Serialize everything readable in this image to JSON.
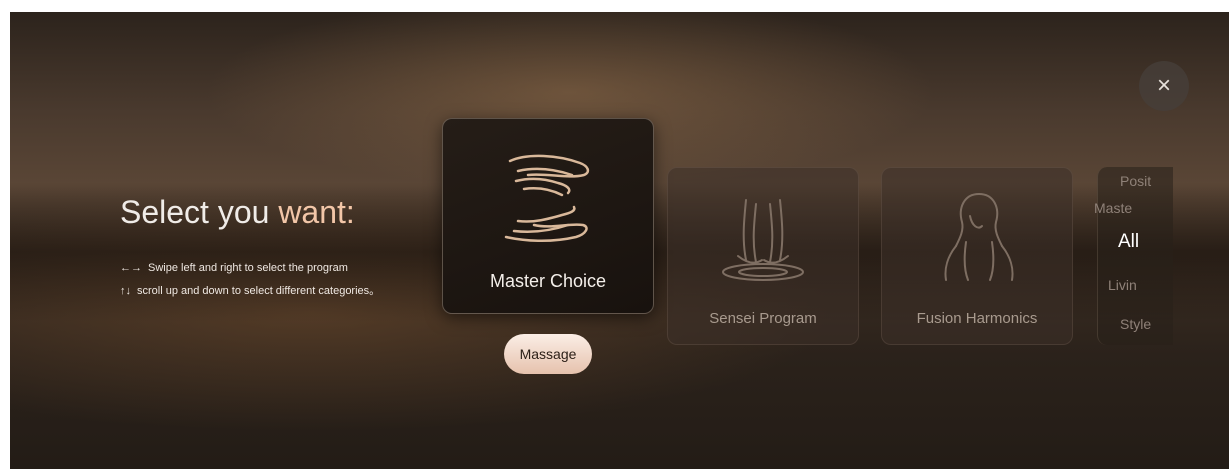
{
  "close": {
    "label": "×"
  },
  "intro": {
    "title_main": "Select you ",
    "title_accent": "want",
    "title_colon": ":",
    "hints": [
      {
        "arrows": "←→",
        "text": "Swipe left and right to select the program"
      },
      {
        "arrows": "↑↓",
        "text": "scroll up and down to select different categories。"
      }
    ]
  },
  "cards": [
    {
      "label": "Master Choice",
      "icon": "hands-icon",
      "selected": true
    },
    {
      "label": "Sensei Program",
      "icon": "feet-water-icon",
      "selected": false
    },
    {
      "label": "Fusion Harmonics",
      "icon": "woman-silhouette-icon",
      "selected": false
    }
  ],
  "category_chip": {
    "label": "Massage"
  },
  "category_picker": {
    "items": [
      {
        "label": "Posit",
        "selected": false
      },
      {
        "label": "Maste",
        "selected": false
      },
      {
        "label": "All",
        "selected": true
      },
      {
        "label": "Livin",
        "selected": false
      },
      {
        "label": "Style",
        "selected": false
      }
    ]
  },
  "colors": {
    "accent": "#f2c6a8",
    "chip_gradient_top": "#fbeee6",
    "chip_gradient_bottom": "#e6c2ad"
  }
}
